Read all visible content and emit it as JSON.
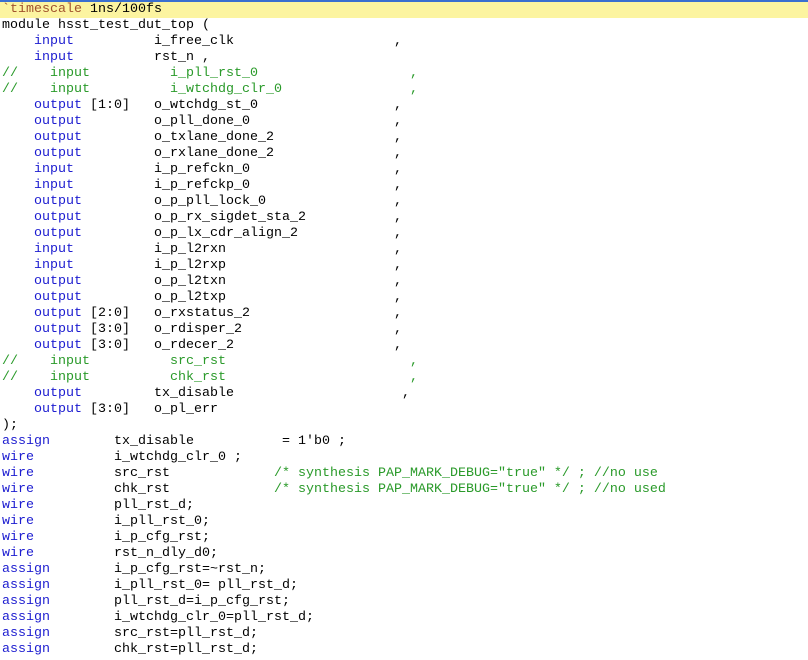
{
  "colors": {
    "keyword": "#1c1cd0",
    "comment": "#2a9a2a",
    "current_line": "#fcf4a0",
    "directive": "#a0522d"
  },
  "header": {
    "directive": "`timescale",
    "value": "1ns/100fs",
    "module_kw": "module",
    "module_name": "hsst_test_dut_top ("
  },
  "ports": [
    {
      "c": false,
      "dir": "input",
      "range": "",
      "name": "i_free_clk",
      "p": ","
    },
    {
      "c": false,
      "dir": "input",
      "range": "",
      "name": "rst_n ,",
      "p": ""
    },
    {
      "c": true,
      "dir": "input",
      "range": "",
      "name": "i_pll_rst_0",
      "p": ","
    },
    {
      "c": true,
      "dir": "input",
      "range": "",
      "name": "i_wtchdg_clr_0",
      "p": ","
    },
    {
      "c": false,
      "dir": "output",
      "range": "[1:0]",
      "name": "o_wtchdg_st_0",
      "p": ","
    },
    {
      "c": false,
      "dir": "output",
      "range": "",
      "name": "o_pll_done_0",
      "p": ","
    },
    {
      "c": false,
      "dir": "output",
      "range": "",
      "name": "o_txlane_done_2",
      "p": ","
    },
    {
      "c": false,
      "dir": "output",
      "range": "",
      "name": "o_rxlane_done_2",
      "p": ","
    },
    {
      "c": false,
      "dir": "input",
      "range": "",
      "name": "i_p_refckn_0",
      "p": ","
    },
    {
      "c": false,
      "dir": "input",
      "range": "",
      "name": "i_p_refckp_0",
      "p": ","
    },
    {
      "c": false,
      "dir": "output",
      "range": "",
      "name": "o_p_pll_lock_0",
      "p": ","
    },
    {
      "c": false,
      "dir": "output",
      "range": "",
      "name": "o_p_rx_sigdet_sta_2",
      "p": ","
    },
    {
      "c": false,
      "dir": "output",
      "range": "",
      "name": "o_p_lx_cdr_align_2",
      "p": ","
    },
    {
      "c": false,
      "dir": "input",
      "range": "",
      "name": "i_p_l2rxn",
      "p": ","
    },
    {
      "c": false,
      "dir": "input",
      "range": "",
      "name": "i_p_l2rxp",
      "p": ","
    },
    {
      "c": false,
      "dir": "output",
      "range": "",
      "name": "o_p_l2txn",
      "p": ","
    },
    {
      "c": false,
      "dir": "output",
      "range": "",
      "name": "o_p_l2txp",
      "p": ","
    },
    {
      "c": false,
      "dir": "output",
      "range": "[2:0]",
      "name": "o_rxstatus_2",
      "p": ","
    },
    {
      "c": false,
      "dir": "output",
      "range": "[3:0]",
      "name": "o_rdisper_2",
      "p": ","
    },
    {
      "c": false,
      "dir": "output",
      "range": "[3:0]",
      "name": "o_rdecer_2",
      "p": ","
    },
    {
      "c": true,
      "dir": "input",
      "range": "",
      "name": "src_rst",
      "p": ","
    },
    {
      "c": true,
      "dir": "input",
      "range": "",
      "name": "chk_rst",
      "p": ","
    },
    {
      "c": false,
      "dir": "output",
      "range": "",
      "name": "tx_disable",
      "p": " ,"
    },
    {
      "c": false,
      "dir": "output",
      "range": "[3:0]",
      "name": "o_pl_err",
      "p": ""
    }
  ],
  "close": ");",
  "decls": [
    {
      "kw": "assign",
      "name": "tx_disable",
      "tail": "= 1'b0 ;",
      "comment": ""
    },
    {
      "kw": "wire",
      "name": "i_wtchdg_clr_0 ;",
      "tail": "",
      "comment": ""
    },
    {
      "kw": "wire",
      "name": "src_rst",
      "tail": "",
      "comment": "/* synthesis PAP_MARK_DEBUG=\"true\" */ ; //no use"
    },
    {
      "kw": "wire",
      "name": "chk_rst",
      "tail": "",
      "comment": "/* synthesis PAP_MARK_DEBUG=\"true\" */ ; //no used"
    },
    {
      "kw": "wire",
      "name": "pll_rst_d;",
      "tail": "",
      "comment": ""
    },
    {
      "kw": "wire",
      "name": "i_pll_rst_0;",
      "tail": "",
      "comment": ""
    },
    {
      "kw": "wire",
      "name": "i_p_cfg_rst;",
      "tail": "",
      "comment": ""
    },
    {
      "kw": "wire",
      "name": "rst_n_dly_d0;",
      "tail": "",
      "comment": ""
    },
    {
      "kw": "assign",
      "name": "i_p_cfg_rst=~rst_n;",
      "tail": "",
      "comment": ""
    },
    {
      "kw": "assign",
      "name": "i_pll_rst_0= pll_rst_d;",
      "tail": "",
      "comment": ""
    },
    {
      "kw": "assign",
      "name": "pll_rst_d=i_p_cfg_rst;",
      "tail": "",
      "comment": ""
    },
    {
      "kw": "assign",
      "name": "i_wtchdg_clr_0=pll_rst_d;",
      "tail": "",
      "comment": ""
    },
    {
      "kw": "assign",
      "name": "src_rst=pll_rst_d;",
      "tail": "",
      "comment": ""
    },
    {
      "kw": "assign",
      "name": "chk_rst=pll_rst_d;",
      "tail": "",
      "comment": ""
    }
  ]
}
